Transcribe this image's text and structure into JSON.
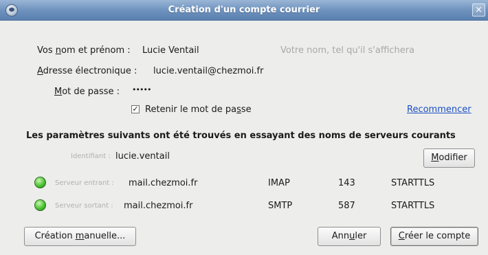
{
  "window": {
    "title": "Création d'un compte courrier",
    "close_glyph": "×"
  },
  "form": {
    "name_label_pre": "Vos ",
    "name_label_u": "n",
    "name_label_post": "om et prénom :",
    "name_value": "Lucie Ventail",
    "name_placeholder": "Votre nom, tel qu'il s'affichera",
    "email_label_u": "A",
    "email_label_post": "dresse électronique :",
    "email_value": "lucie.ventail@chezmoi.fr",
    "password_label_u": "M",
    "password_label_post": "ot de passe :",
    "password_value": "•••••",
    "remember_checked": true,
    "remember_glyph": "✓",
    "remember_label_pre": "Retenir le mot de pa",
    "remember_label_u": "s",
    "remember_label_post": "se",
    "restart_link": "Recommencer"
  },
  "settings": {
    "heading": "Les paramètres suivants ont été trouvés en essayant des noms de serveurs courants",
    "identifier_label": "Identifiant :",
    "identifier_value": "lucie.ventail",
    "modify_pre": "",
    "modify_u": "M",
    "modify_post": "odifier",
    "incoming": {
      "label": "Serveur entrant :",
      "host": "mail.chezmoi.fr",
      "protocol": "IMAP",
      "port": "143",
      "security": "STARTTLS",
      "status_color": "#4dc431"
    },
    "outgoing": {
      "label": "Serveur sortant :",
      "host": "mail.chezmoi.fr",
      "protocol": "SMTP",
      "port": "587",
      "security": "STARTTLS",
      "status_color": "#4dc431"
    }
  },
  "buttons": {
    "manual_pre": "Création ",
    "manual_u": "m",
    "manual_post": "anuelle...",
    "cancel_pre": "Ann",
    "cancel_u": "u",
    "cancel_post": "ler",
    "create_pre": "",
    "create_u": "C",
    "create_post": "réer le compte"
  }
}
